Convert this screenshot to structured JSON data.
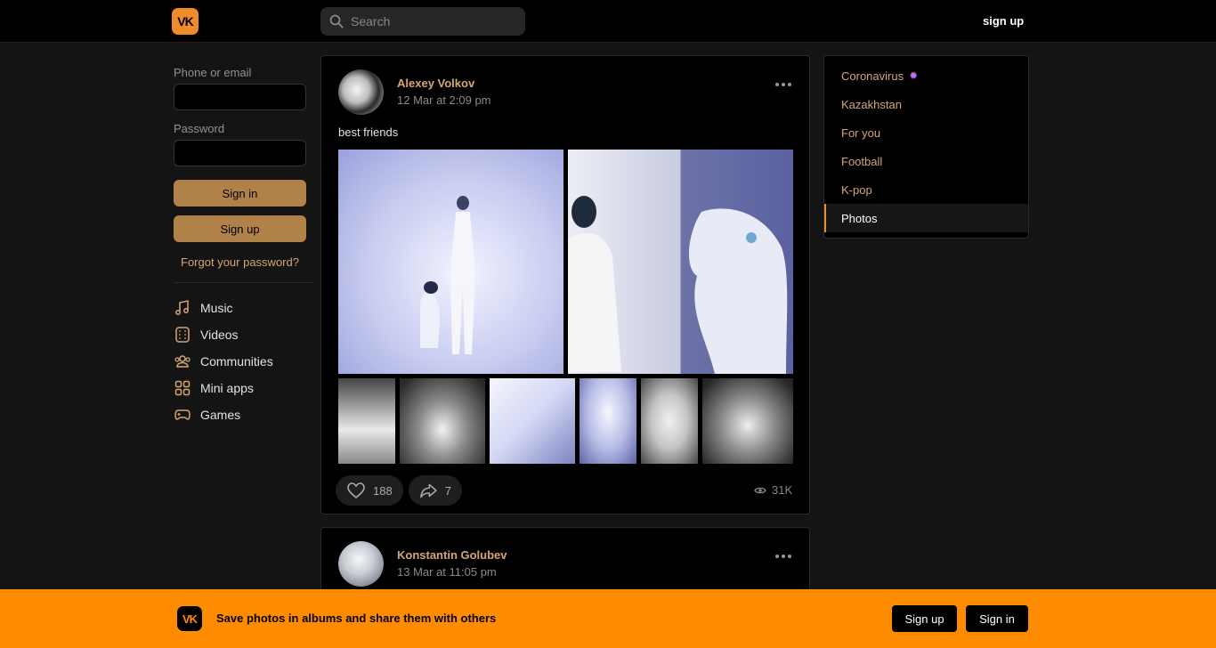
{
  "header": {
    "logo_text": "VK",
    "search_placeholder": "Search",
    "signup_label": "sign up"
  },
  "login": {
    "phone_label": "Phone or email",
    "password_label": "Password",
    "signin_label": "Sign in",
    "signup_label": "Sign up",
    "forgot_label": "Forgot your password?"
  },
  "nav": [
    {
      "label": "Music",
      "icon": "music-icon"
    },
    {
      "label": "Videos",
      "icon": "videos-icon"
    },
    {
      "label": "Communities",
      "icon": "communities-icon"
    },
    {
      "label": "Mini apps",
      "icon": "mini-apps-icon"
    },
    {
      "label": "Games",
      "icon": "games-icon"
    }
  ],
  "posts": [
    {
      "author": "Alexey Volkov",
      "date": "12 Mar at 2:09 pm",
      "text": "best friends",
      "likes": "188",
      "shares": "7",
      "views": "31K"
    },
    {
      "author": "Konstantin Golubev",
      "date": "13 Mar at 11:05 pm"
    }
  ],
  "topics": [
    {
      "label": "Coronavirus",
      "badge": "virus-icon"
    },
    {
      "label": "Kazakhstan"
    },
    {
      "label": "For you"
    },
    {
      "label": "Football"
    },
    {
      "label": "K-pop"
    },
    {
      "label": "Photos",
      "active": true
    }
  ],
  "banner": {
    "logo_text": "VK",
    "text": "Save photos in albums and share them with others",
    "signup_label": "Sign up",
    "signin_label": "Sign in"
  },
  "colors": {
    "accent": "#f08b2b",
    "link": "#d6a574",
    "banner": "#ff8c00"
  }
}
